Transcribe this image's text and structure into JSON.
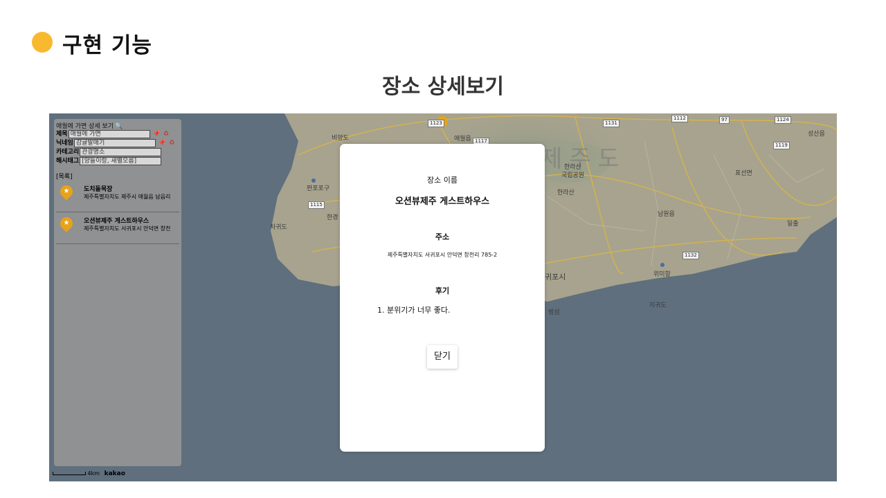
{
  "slide": {
    "title": "구현 기능",
    "section_title": "장소 상세보기",
    "bullet_color": "#F8B92E"
  },
  "map": {
    "labels": {
      "biyangdo": "비양도",
      "aewol": "애월읍",
      "hallasan": "한라산",
      "national_park": "국립공원",
      "hallasan2": "한라산",
      "seongsan": "성산읍",
      "pyoseon": "표선면",
      "namwon": "남원읍",
      "seogwipo": "귀포시",
      "wimi": "위미항",
      "jigwido_e": "지귀도",
      "beomseom": "범섬",
      "jigwido_w": "차귀도",
      "hangyeong": "한경",
      "panpo": "판포포구",
      "seongsan_ilchul": "일출"
    },
    "big_label": "제주도",
    "road_badges": [
      "1123",
      "1117",
      "1131",
      "1112",
      "97",
      "1124",
      "1119",
      "1115",
      "1132"
    ],
    "water_color": "#5f6f7d",
    "land_color": "#a7a38e"
  },
  "panel": {
    "header": "애월에 가면 상세 보기",
    "search_icon": "magnifier-icon",
    "fields": [
      {
        "label": "제목",
        "value": "애월에 가면"
      },
      {
        "label": "닉네임",
        "value": "감귤발매기"
      },
      {
        "label": "카테고리",
        "value": "관광명소"
      },
      {
        "label": "해시태그",
        "value": "[양들이랑, 새별오름]"
      }
    ],
    "list_title": "[목록]",
    "places": [
      {
        "name": "도치돌목장",
        "address": "제주특별자치도 제주시 애월읍 납읍리"
      },
      {
        "name": "오션뷰제주 게스트하우스",
        "address": "제주특별자치도 서귀포시 안덕면 창천"
      }
    ],
    "scale_text": "4km",
    "brand": "kakao"
  },
  "modal": {
    "name_label": "장소 이름",
    "name_value": "오션뷰제주 게스트하우스",
    "address_label": "주소",
    "address_value": "제주특별자치도 서귀포시 안덕면 창천리 785-2",
    "review_label": "후기",
    "review_item": "1. 분위기가 너무 좋다.",
    "close_label": "닫기"
  }
}
